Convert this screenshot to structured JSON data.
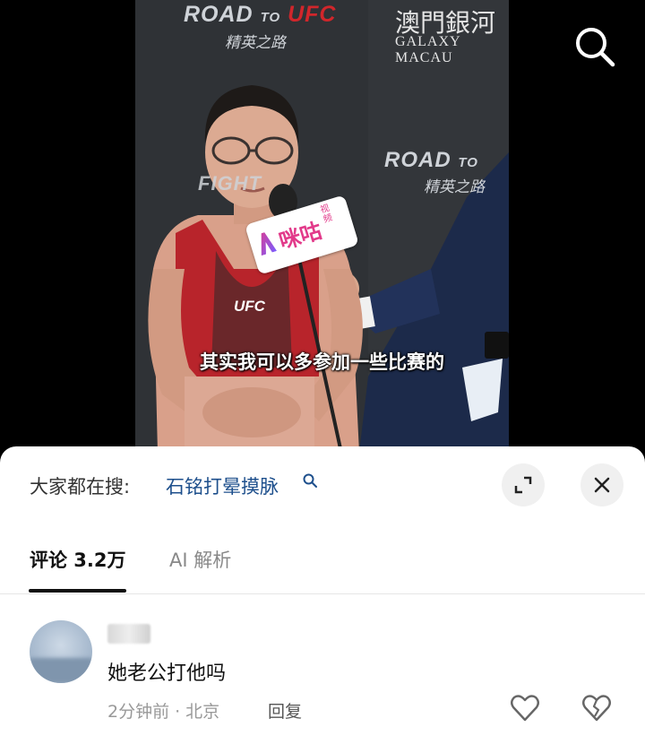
{
  "video": {
    "top_logo_road": "ROAD",
    "top_logo_to": "TO",
    "top_logo_ufc": "UFC",
    "top_logo_sub": "精英之路",
    "galaxy_cn": "澳門銀河",
    "galaxy_en": "GALAXY MACAU",
    "right_logo_road": "ROAD",
    "right_logo_to": "TO",
    "right_logo_sub": "精英之路",
    "left_logo_text": "FIGHT",
    "mic_brand": "咪咕",
    "mic_brand_small": "视频",
    "shirt_logo": "UFC",
    "subtitle": "其实我可以多参加一些比赛的",
    "search_icon": "search-icon"
  },
  "sheet": {
    "hot_search_label": "大家都在搜:",
    "hot_search_term": "石铭打晕摸脉",
    "expand_icon": "expand-icon",
    "close_icon": "close-icon",
    "tabs": [
      {
        "label": "评论 3.2万",
        "active": true
      },
      {
        "label": "AI 解析",
        "active": false
      }
    ]
  },
  "comments": [
    {
      "text": "她老公打他吗",
      "time": "2分钟前",
      "location": "北京",
      "reply_label": "回复",
      "like_icon": "heart-icon",
      "dislike_icon": "broken-heart-icon"
    }
  ],
  "colors": {
    "link": "#1d4f8c",
    "ufc_red": "#d1262b",
    "sheet_bg": "#ffffff"
  }
}
